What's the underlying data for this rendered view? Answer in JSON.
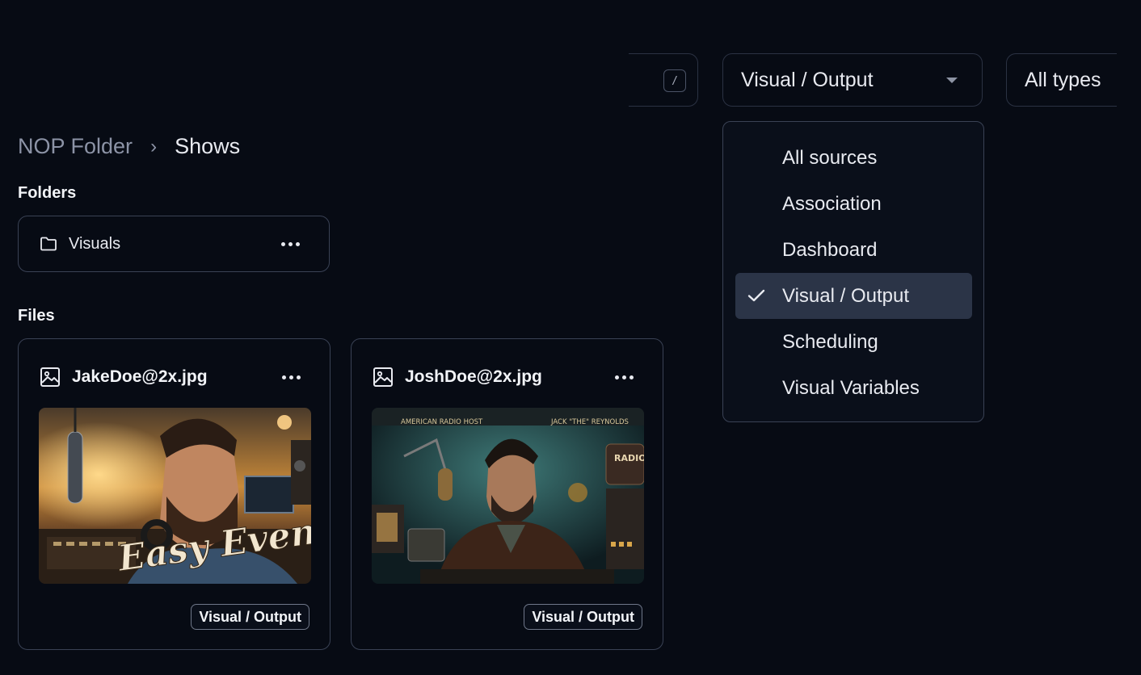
{
  "search": {
    "shortcut": "/"
  },
  "source_filter": {
    "value": "Visual / Output",
    "options": [
      "All sources",
      "Association",
      "Dashboard",
      "Visual / Output",
      "Scheduling",
      "Visual Variables"
    ],
    "selected_index": 3
  },
  "type_filter": {
    "value": "All types"
  },
  "breadcrumb": {
    "root": "NOP Folder",
    "separator": "›",
    "current": "Shows"
  },
  "folders": {
    "title": "Folders",
    "items": [
      {
        "name": "Visuals"
      }
    ]
  },
  "files": {
    "title": "Files",
    "items": [
      {
        "name": "JakeDoe@2x.jpg",
        "tag": "Visual / Output",
        "thumb_text": "Easy Evening"
      },
      {
        "name": "JoshDoe@2x.jpg",
        "tag": "Visual / Output",
        "thumb_header_left": "AMERICAN RADIO HOST",
        "thumb_header_right": "JACK \"THE\" REYNOLDS",
        "thumb_sign": "RADIO"
      }
    ]
  }
}
